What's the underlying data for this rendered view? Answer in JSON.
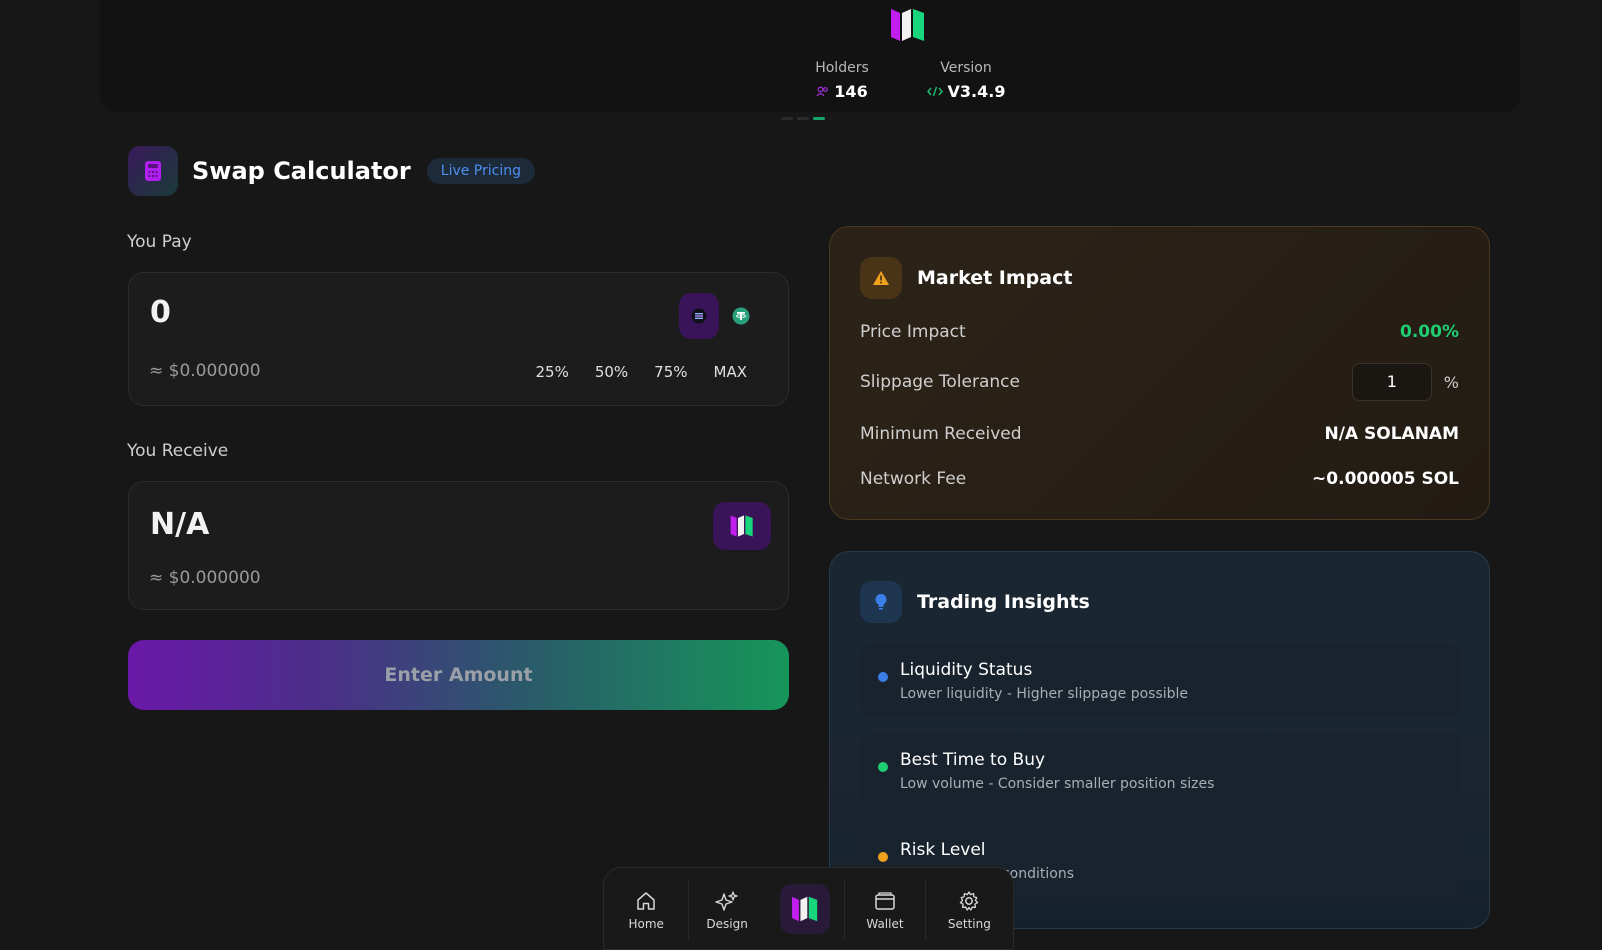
{
  "header": {
    "holders_label": "Holders",
    "holders_value": "146",
    "version_label": "Version",
    "version_value": "V3.4.9"
  },
  "calculator": {
    "title": "Swap Calculator",
    "badge": "Live Pricing",
    "you_pay_label": "You Pay",
    "pay_amount": "0",
    "pay_usd": "≈ $0.000000",
    "percent_buttons": [
      "25%",
      "50%",
      "75%",
      "MAX"
    ],
    "you_receive_label": "You Receive",
    "receive_amount": "N/A",
    "receive_usd": "≈ $0.000000",
    "action_button": "Enter Amount"
  },
  "market_impact": {
    "title": "Market Impact",
    "price_impact_label": "Price Impact",
    "price_impact_value": "0.00%",
    "slippage_label": "Slippage Tolerance",
    "slippage_value": "1",
    "slippage_unit": "%",
    "min_received_label": "Minimum Received",
    "min_received_value": "N/A SOLANAM",
    "network_fee_label": "Network Fee",
    "network_fee_value": "~0.000005 SOL"
  },
  "insights": {
    "title": "Trading Insights",
    "items": [
      {
        "title": "Liquidity Status",
        "subtitle": "Lower liquidity - Higher slippage possible",
        "color": "#3b7fe8"
      },
      {
        "title": "Best Time to Buy",
        "subtitle": "Low volume - Consider smaller position sizes",
        "color": "#1fce72"
      },
      {
        "title": "Risk Level",
        "subtitle": "High - Volatile conditions",
        "color": "#f0a21e"
      }
    ]
  },
  "nav": {
    "home": "Home",
    "design": "Design",
    "wallet": "Wallet",
    "setting": "Setting"
  },
  "colors": {
    "accent_purple": "#b020f0",
    "accent_green": "#20e080",
    "background": "#171717"
  }
}
